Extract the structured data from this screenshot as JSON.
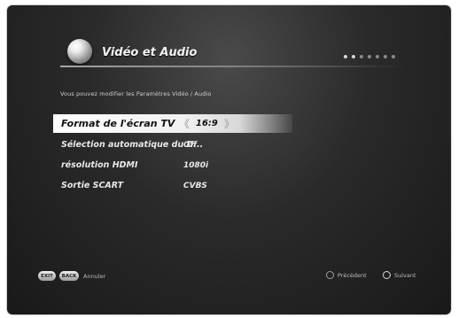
{
  "header": {
    "title": "Vidéo et Audio",
    "logo_icon": "globe-icon",
    "page_dots_total": 7,
    "page_dots_active": 2
  },
  "subtitle": "Vous pouvez modifier les Paramètres Vidéo / Audio",
  "menu": {
    "items": [
      {
        "label": "Format de l'écran TV",
        "value": "16:9",
        "selected": true
      },
      {
        "label": "Sélection automatique du D...",
        "value": "Off",
        "selected": false
      },
      {
        "label": "résolution HDMI",
        "value": "1080i",
        "selected": false
      },
      {
        "label": "Sortie SCART",
        "value": "CVBS",
        "selected": false
      }
    ],
    "left_arrow": "《",
    "right_arrow": "》"
  },
  "footer": {
    "exit_label": "EXIT",
    "back_label": "BACK",
    "cancel_label": "Annuler",
    "previous_label": "Précédent",
    "next_label": "Suivant"
  },
  "colors": {
    "background": "#1f1f1f",
    "text": "#e8e8e8",
    "highlight": "#f4f4f4"
  }
}
